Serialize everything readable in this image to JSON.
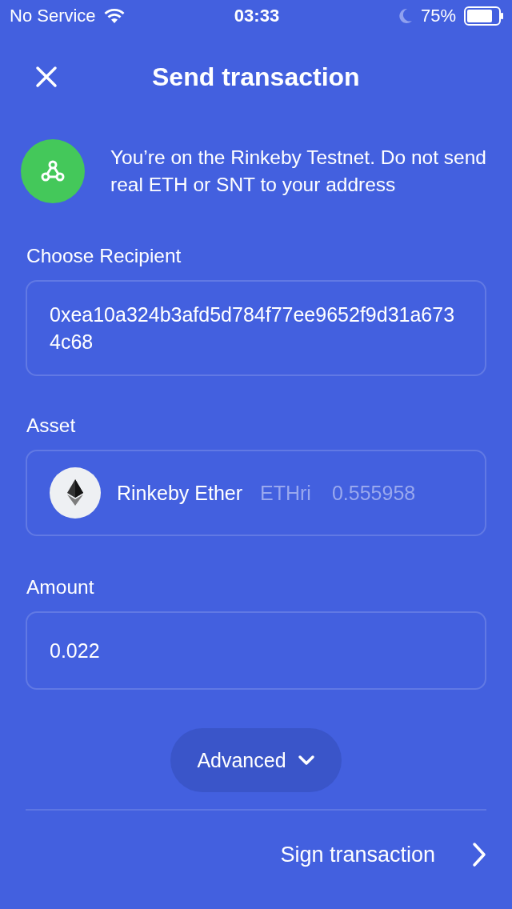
{
  "status_bar": {
    "carrier": "No Service",
    "time": "03:33",
    "battery": "75%"
  },
  "header": {
    "title": "Send transaction"
  },
  "notice": {
    "text": "You’re on the Rinkeby Testnet. Do not send real ETH or SNT to your address"
  },
  "recipient": {
    "label": "Choose Recipient",
    "value": "0xea10a324b3afd5d784f77ee9652f9d31a6734c68"
  },
  "asset": {
    "label": "Asset",
    "name": "Rinkeby Ether",
    "symbol": "ETHri",
    "balance": "0.555958"
  },
  "amount": {
    "label": "Amount",
    "value": "0.022"
  },
  "advanced": {
    "label": "Advanced",
    "expanded": false
  },
  "footer": {
    "action": "Sign transaction"
  }
}
